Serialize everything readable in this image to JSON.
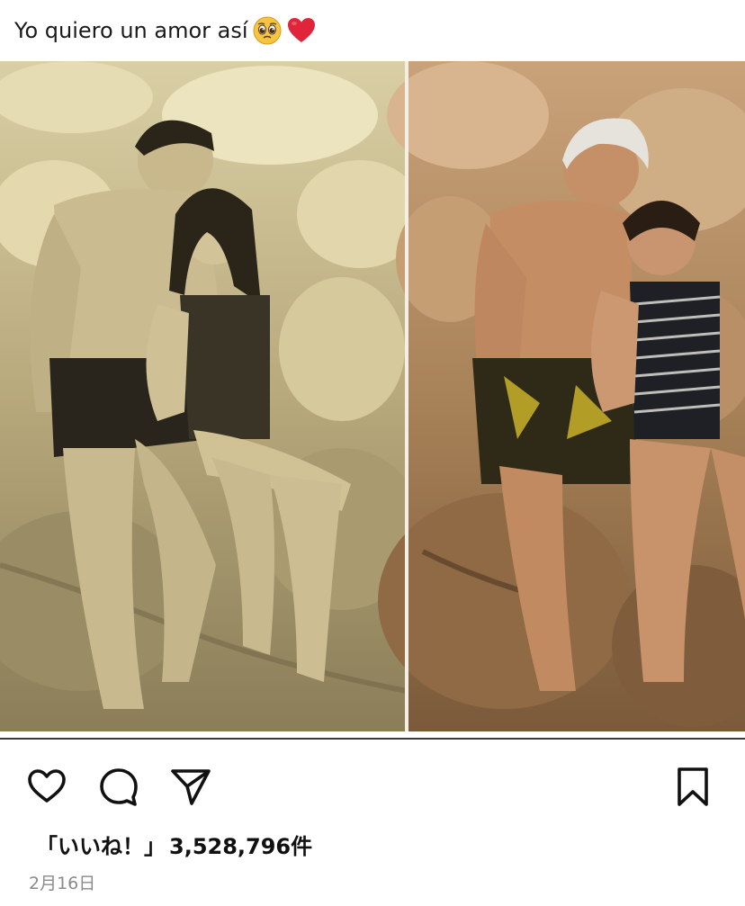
{
  "post": {
    "caption": "Yo quiero un amor así",
    "caption_emojis": [
      "pleading-face-emoji",
      "red-heart-emoji"
    ],
    "likes_label": "「いいね！」",
    "likes_count": "3,528,796件",
    "date": "2月16日"
  },
  "actions": {
    "like_icon": "heart-outline-icon",
    "comment_icon": "speech-bubble-icon",
    "share_icon": "paper-plane-icon",
    "save_icon": "bookmark-outline-icon"
  },
  "colors": {
    "heart_emoji": "#e0243a",
    "date_text": "#8a8a8a",
    "icon_stroke": "#111111"
  }
}
